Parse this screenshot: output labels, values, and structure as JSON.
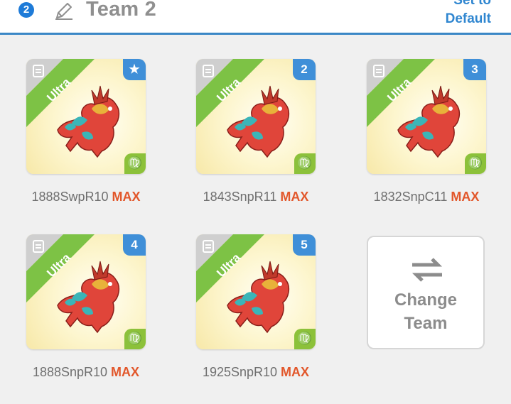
{
  "header": {
    "team_number": "2",
    "team_name": "Team 2",
    "set_default_line1": "Set to",
    "set_default_line2": "Default"
  },
  "cards": [
    {
      "tag": "★",
      "tag_icon": "star-icon",
      "rarity": "Ultra",
      "sign": "♍",
      "name": "1888SwpR10",
      "level": "MAX"
    },
    {
      "tag": "2",
      "rarity": "Ultra",
      "sign": "♍",
      "name": "1843SnpR11",
      "level": "MAX"
    },
    {
      "tag": "3",
      "rarity": "Ultra",
      "sign": "♍",
      "name": "1832SnpC11",
      "level": "MAX"
    },
    {
      "tag": "4",
      "rarity": "Ultra",
      "sign": "♍",
      "name": "1888SnpR10",
      "level": "MAX"
    },
    {
      "tag": "5",
      "rarity": "Ultra",
      "sign": "♍",
      "name": "1925SnpR10",
      "level": "MAX"
    }
  ],
  "change_team": {
    "line1": "Change",
    "line2": "Team"
  },
  "colors": {
    "accent_blue": "#2f86d0",
    "ribbon_green": "#7dc245",
    "max_orange": "#e2572b",
    "sign_green": "#8cc13a"
  }
}
